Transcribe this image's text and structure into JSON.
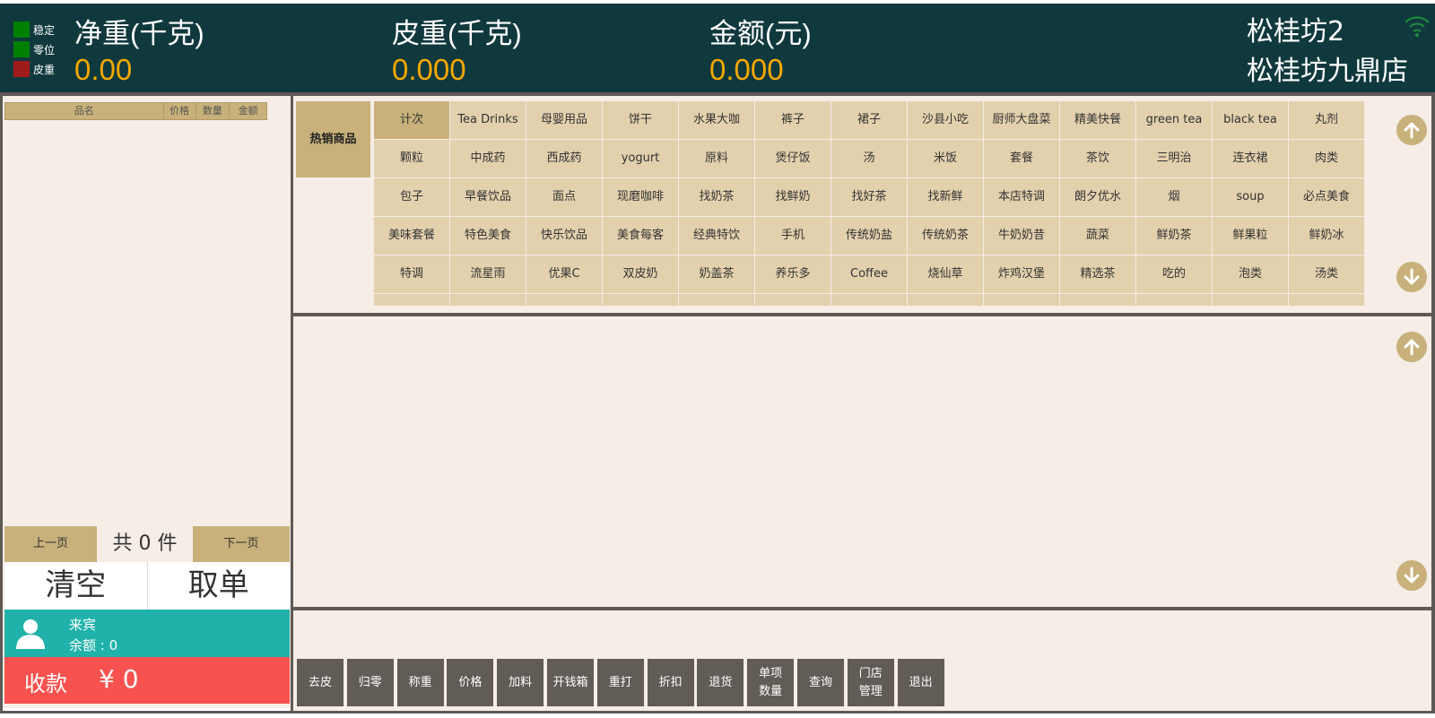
{
  "indicators": [
    {
      "label": "稳定",
      "color": "#008000"
    },
    {
      "label": "零位",
      "color": "#008000"
    },
    {
      "label": "皮重",
      "color": "#a01c1c"
    }
  ],
  "scale": {
    "net": {
      "label": "净重(千克)",
      "value": "0.00"
    },
    "tare": {
      "label": "皮重(千克)",
      "value": "0.000"
    },
    "amount": {
      "label": "金额(元)",
      "value": "0.000"
    }
  },
  "store": {
    "line1": "松桂坊2",
    "line2": "松桂坊九鼎店"
  },
  "order": {
    "columns": [
      "品名",
      "价格",
      "数量",
      "金额"
    ],
    "prev": "上一页",
    "next": "下一页",
    "count": "共 0 件",
    "clear": "清空",
    "cancel": "取单"
  },
  "member": {
    "name": "来宾",
    "balance": "余额 : 0"
  },
  "pay": {
    "label": "收款",
    "amount": "¥ 0"
  },
  "categories": {
    "hot": "热销商品",
    "items": [
      "计次",
      "Tea Drinks",
      "母婴用品",
      "饼干",
      "水果大咖",
      "裤子",
      "裙子",
      "沙县小吃",
      "厨师大盘菜",
      "精美快餐",
      "green tea",
      "black tea",
      "丸剂",
      "颗粒",
      "中成药",
      "西成药",
      "yogurt",
      "原料",
      "煲仔饭",
      "汤",
      "米饭",
      "套餐",
      "茶饮",
      "三明治",
      "连衣裙",
      "肉类",
      "包子",
      "早餐饮品",
      "面点",
      "现磨咖啡",
      "找奶茶",
      "找鲜奶",
      "找好茶",
      "找新鲜",
      "本店特调",
      "朗夕优水",
      "烟",
      "soup",
      "必点美食",
      "美味套餐",
      "特色美食",
      "快乐饮品",
      "美食每客",
      "经典特饮",
      "手机",
      "传统奶盐",
      "传统奶茶",
      "牛奶奶昔",
      "蔬菜",
      "鲜奶茶",
      "鲜果粒",
      "鲜奶冰",
      "特调",
      "流星雨",
      "优果C",
      "双皮奶",
      "奶盖茶",
      "养乐多",
      "Coffee",
      "烧仙草",
      "炸鸡汉堡",
      "精选茶",
      "吃的",
      "泡类",
      "汤类",
      "",
      "",
      "",
      "",
      "",
      "",
      "",
      "",
      "",
      "",
      "",
      "",
      ""
    ]
  },
  "functions": [
    "去皮",
    "归零",
    "称重",
    "价格",
    "加料",
    "开钱箱",
    "重打",
    "折扣",
    "退货",
    "单项\n数量",
    "查询",
    "门店\n管理",
    "退出"
  ],
  "colors": {
    "header": "#10393d",
    "accent": "#c8b17a",
    "member": "#20b2aa",
    "pay": "#f7524f",
    "value": "#f5a800"
  }
}
